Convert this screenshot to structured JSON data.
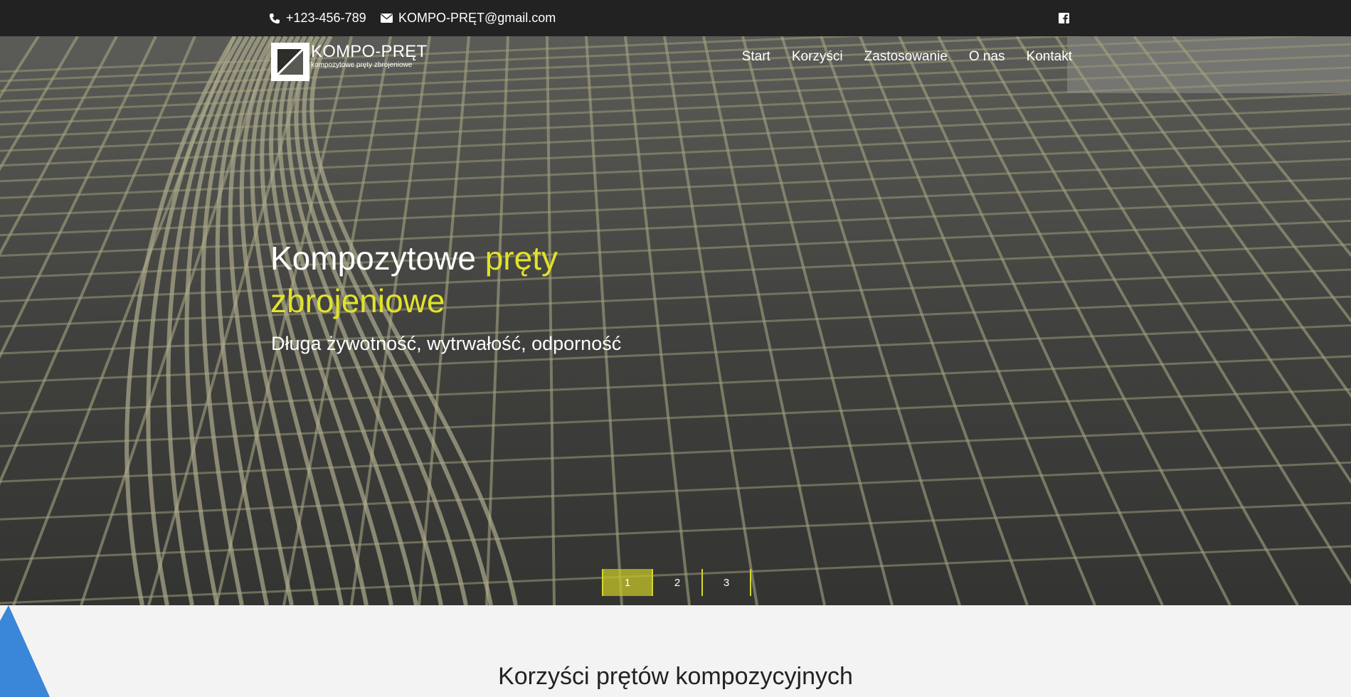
{
  "topbar": {
    "phone": "+123-456-789",
    "email": "KOMPO-PRĘT@gmail.com",
    "icons": [
      "phone-icon",
      "envelope-icon",
      "facebook-icon"
    ]
  },
  "logo": {
    "name": "KOMPO-PRĘT",
    "tagline": "kompozytowe pręty zbrojeniowe"
  },
  "nav": {
    "items": [
      "Start",
      "Korzyści",
      "Zastosowanie",
      "O nas",
      "Kontakt"
    ]
  },
  "hero": {
    "headline_plain": "Kompozytowe ",
    "headline_accent": "pręty zbrojeniowe",
    "subhead": "Długa żywotność, wytrwałość, odporność",
    "slides": [
      "1",
      "2",
      "3"
    ],
    "active_slide": "1"
  },
  "section": {
    "title": "Korzyści prętów kompozycyjnych"
  },
  "colors": {
    "topbar": "#222222",
    "accent": "#e2e22c",
    "pager_active": "#c4c428",
    "corner_blue": "#3a86d8"
  }
}
